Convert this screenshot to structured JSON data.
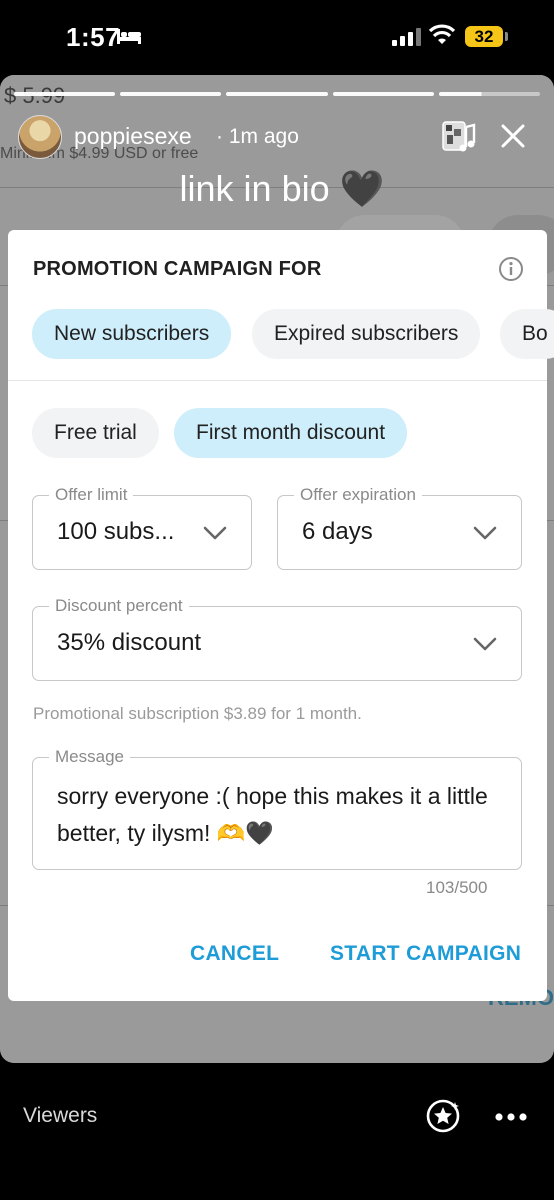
{
  "status_bar": {
    "time": "1:57",
    "battery": "32"
  },
  "background_page": {
    "price_text": "$ 5.99",
    "min_text": "Minimum $4.99 USD or free",
    "remove_text": "REMO"
  },
  "story": {
    "username": "poppiesexe",
    "time_ago": "· 1m ago",
    "caption": "link in bio 🖤",
    "progress_segments": 5,
    "current_segment_progress": 0.42
  },
  "dialog": {
    "title": "PROMOTION CAMPAIGN FOR",
    "audience_chips": [
      "New subscribers",
      "Expired subscribers",
      "Bo"
    ],
    "audience_selected": "New subscribers",
    "type_chips": [
      "Free trial",
      "First month discount"
    ],
    "type_selected": "First month discount",
    "offer_limit": {
      "label": "Offer limit",
      "value": "100 subs..."
    },
    "offer_expiration": {
      "label": "Offer expiration",
      "value": "6 days"
    },
    "discount_percent": {
      "label": "Discount percent",
      "value": "35% discount"
    },
    "helper_text": "Promotional subscription $3.89 for 1 month.",
    "message": {
      "label": "Message",
      "value": "sorry everyone :( hope this makes it a little better, ty ilysm! 🫶🖤"
    },
    "counter": "103/500",
    "cancel_label": "CANCEL",
    "start_label": "START CAMPAIGN"
  },
  "bottom_bar": {
    "viewers_label": "Viewers"
  },
  "colors": {
    "accent": "#1e9cd7",
    "chip_active": "#cdeefa",
    "chip": "#f1f3f4",
    "battery": "#f5c518"
  }
}
